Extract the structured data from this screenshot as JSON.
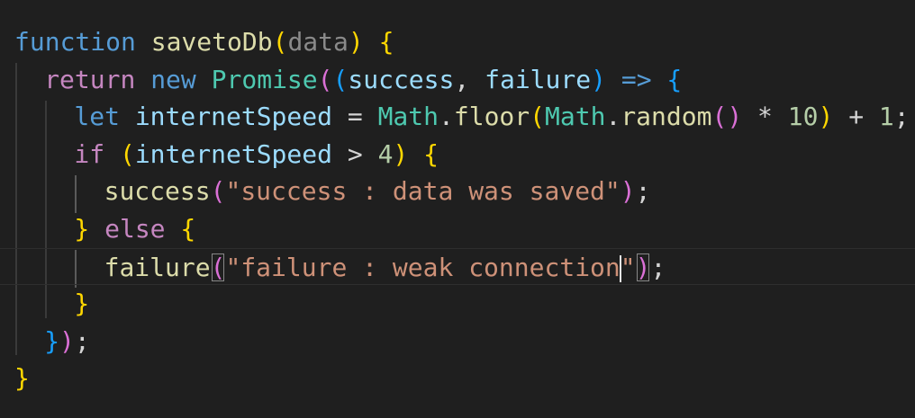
{
  "editor": {
    "lines": [
      {
        "tokens": [
          {
            "t": "function",
            "c": "kw-blue"
          },
          {
            "t": " ",
            "c": "punc"
          },
          {
            "t": "savetoDb",
            "c": "fn"
          },
          {
            "t": "(",
            "c": "b1"
          },
          {
            "t": "data",
            "c": "param-dim"
          },
          {
            "t": ")",
            "c": "b1"
          },
          {
            "t": " ",
            "c": "punc"
          },
          {
            "t": "{",
            "c": "b1"
          }
        ]
      },
      {
        "tokens": [
          {
            "t": "return",
            "c": "kw-purple"
          },
          {
            "t": " ",
            "c": "punc"
          },
          {
            "t": "new",
            "c": "kw-blue"
          },
          {
            "t": " ",
            "c": "punc"
          },
          {
            "t": "Promise",
            "c": "cls"
          },
          {
            "t": "(",
            "c": "b2"
          },
          {
            "t": "(",
            "c": "b3"
          },
          {
            "t": "success",
            "c": "var"
          },
          {
            "t": ", ",
            "c": "punc"
          },
          {
            "t": "failure",
            "c": "var"
          },
          {
            "t": ")",
            "c": "b3"
          },
          {
            "t": " ",
            "c": "punc"
          },
          {
            "t": "=>",
            "c": "kw-blue"
          },
          {
            "t": " ",
            "c": "punc"
          },
          {
            "t": "{",
            "c": "b3"
          }
        ]
      },
      {
        "tokens": [
          {
            "t": "let",
            "c": "kw-blue"
          },
          {
            "t": " ",
            "c": "punc"
          },
          {
            "t": "internetSpeed",
            "c": "var"
          },
          {
            "t": " = ",
            "c": "punc"
          },
          {
            "t": "Math",
            "c": "cls"
          },
          {
            "t": ".",
            "c": "punc"
          },
          {
            "t": "floor",
            "c": "fn"
          },
          {
            "t": "(",
            "c": "b1"
          },
          {
            "t": "Math",
            "c": "cls"
          },
          {
            "t": ".",
            "c": "punc"
          },
          {
            "t": "random",
            "c": "fn"
          },
          {
            "t": "()",
            "c": "b2"
          },
          {
            "t": " * ",
            "c": "punc"
          },
          {
            "t": "10",
            "c": "num"
          },
          {
            "t": ")",
            "c": "b1"
          },
          {
            "t": " + ",
            "c": "punc"
          },
          {
            "t": "1",
            "c": "num"
          },
          {
            "t": ";",
            "c": "punc"
          }
        ]
      },
      {
        "tokens": [
          {
            "t": "if",
            "c": "kw-purple"
          },
          {
            "t": " ",
            "c": "punc"
          },
          {
            "t": "(",
            "c": "b1"
          },
          {
            "t": "internetSpeed",
            "c": "var"
          },
          {
            "t": " > ",
            "c": "punc"
          },
          {
            "t": "4",
            "c": "num"
          },
          {
            "t": ")",
            "c": "b1"
          },
          {
            "t": " ",
            "c": "punc"
          },
          {
            "t": "{",
            "c": "b1"
          }
        ]
      },
      {
        "tokens": [
          {
            "t": "success",
            "c": "fn"
          },
          {
            "t": "(",
            "c": "b2"
          },
          {
            "t": "\"success : data was saved\"",
            "c": "str"
          },
          {
            "t": ")",
            "c": "b2"
          },
          {
            "t": ";",
            "c": "punc"
          }
        ]
      },
      {
        "tokens": [
          {
            "t": "}",
            "c": "b1"
          },
          {
            "t": " ",
            "c": "punc"
          },
          {
            "t": "else",
            "c": "kw-purple"
          },
          {
            "t": " ",
            "c": "punc"
          },
          {
            "t": "{",
            "c": "b1"
          }
        ]
      },
      {
        "tokens": [
          {
            "t": "failure",
            "c": "fn"
          },
          {
            "t": "(",
            "c": "b2",
            "match": true
          },
          {
            "t": "\"failure : weak connection",
            "c": "str"
          },
          {
            "t": "",
            "c": "cursor"
          },
          {
            "t": "\"",
            "c": "str"
          },
          {
            "t": ")",
            "c": "b2",
            "match": true
          },
          {
            "t": ";",
            "c": "punc"
          }
        ]
      },
      {
        "tokens": [
          {
            "t": "}",
            "c": "b1"
          }
        ]
      },
      {
        "tokens": [
          {
            "t": "}",
            "c": "b3"
          },
          {
            "t": ")",
            "c": "b2"
          },
          {
            "t": ";",
            "c": "punc"
          }
        ]
      },
      {
        "tokens": [
          {
            "t": "}",
            "c": "b1"
          }
        ]
      }
    ]
  }
}
